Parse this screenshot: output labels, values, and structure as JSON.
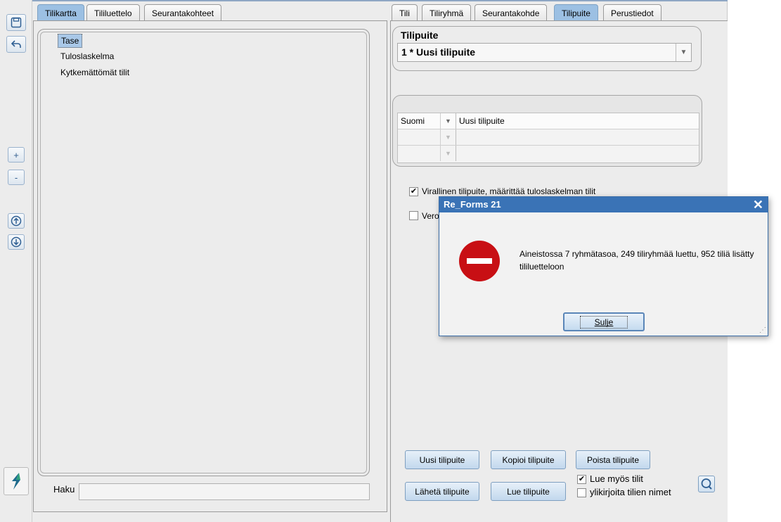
{
  "left_tabs": [
    "Tilikartta",
    "Tililuettelo",
    "Seurantakohteet"
  ],
  "right_tabs": [
    "Tili",
    "Tiliryhmä",
    "Seurantakohde",
    "Tilipuite",
    "Perustiedot"
  ],
  "toolbar": {
    "zoom_in": "+",
    "zoom_out": "-"
  },
  "tree": {
    "items": [
      "Tase",
      "Tuloslaskelma",
      "Kytkemättömät tilit"
    ]
  },
  "search": {
    "label": "Haku",
    "value": ""
  },
  "tilipuite": {
    "label": "Tilipuite",
    "selected": "1 * Uusi tilipuite"
  },
  "translations": {
    "rows": [
      {
        "language": "Suomi",
        "text": "Uusi tilipuite"
      },
      {
        "language": "",
        "text": ""
      },
      {
        "language": "",
        "text": ""
      }
    ]
  },
  "checkboxes": {
    "virallinen": {
      "label": "Virallinen tilipuite, määrittää tuloslaskelman tilit",
      "checked": true
    },
    "vero": {
      "label": "Vero",
      "checked": false
    },
    "lue_myos_tilit": {
      "label": "Lue myös tilit",
      "checked": true
    },
    "ylikirjoita": {
      "label": "ylikirjoita tilien nimet",
      "checked": false
    }
  },
  "buttons": {
    "uusi": "Uusi tilipuite",
    "kopioi": "Kopioi tilipuite",
    "poista": "Poista tilipuite",
    "laheta": "Lähetä tilipuite",
    "lue": "Lue tilipuite"
  },
  "dialog": {
    "title": "Re_Forms 21",
    "message": "Aineistossa 7 ryhmätasoa, 249 tiliryhmää luettu, 952 tiliä lisätty tililuetteloon",
    "button": "Sulje"
  },
  "colors": {
    "accent": "#9cc0e3",
    "title_bar": "#3a73b6",
    "error_icon": "#c80f14"
  }
}
